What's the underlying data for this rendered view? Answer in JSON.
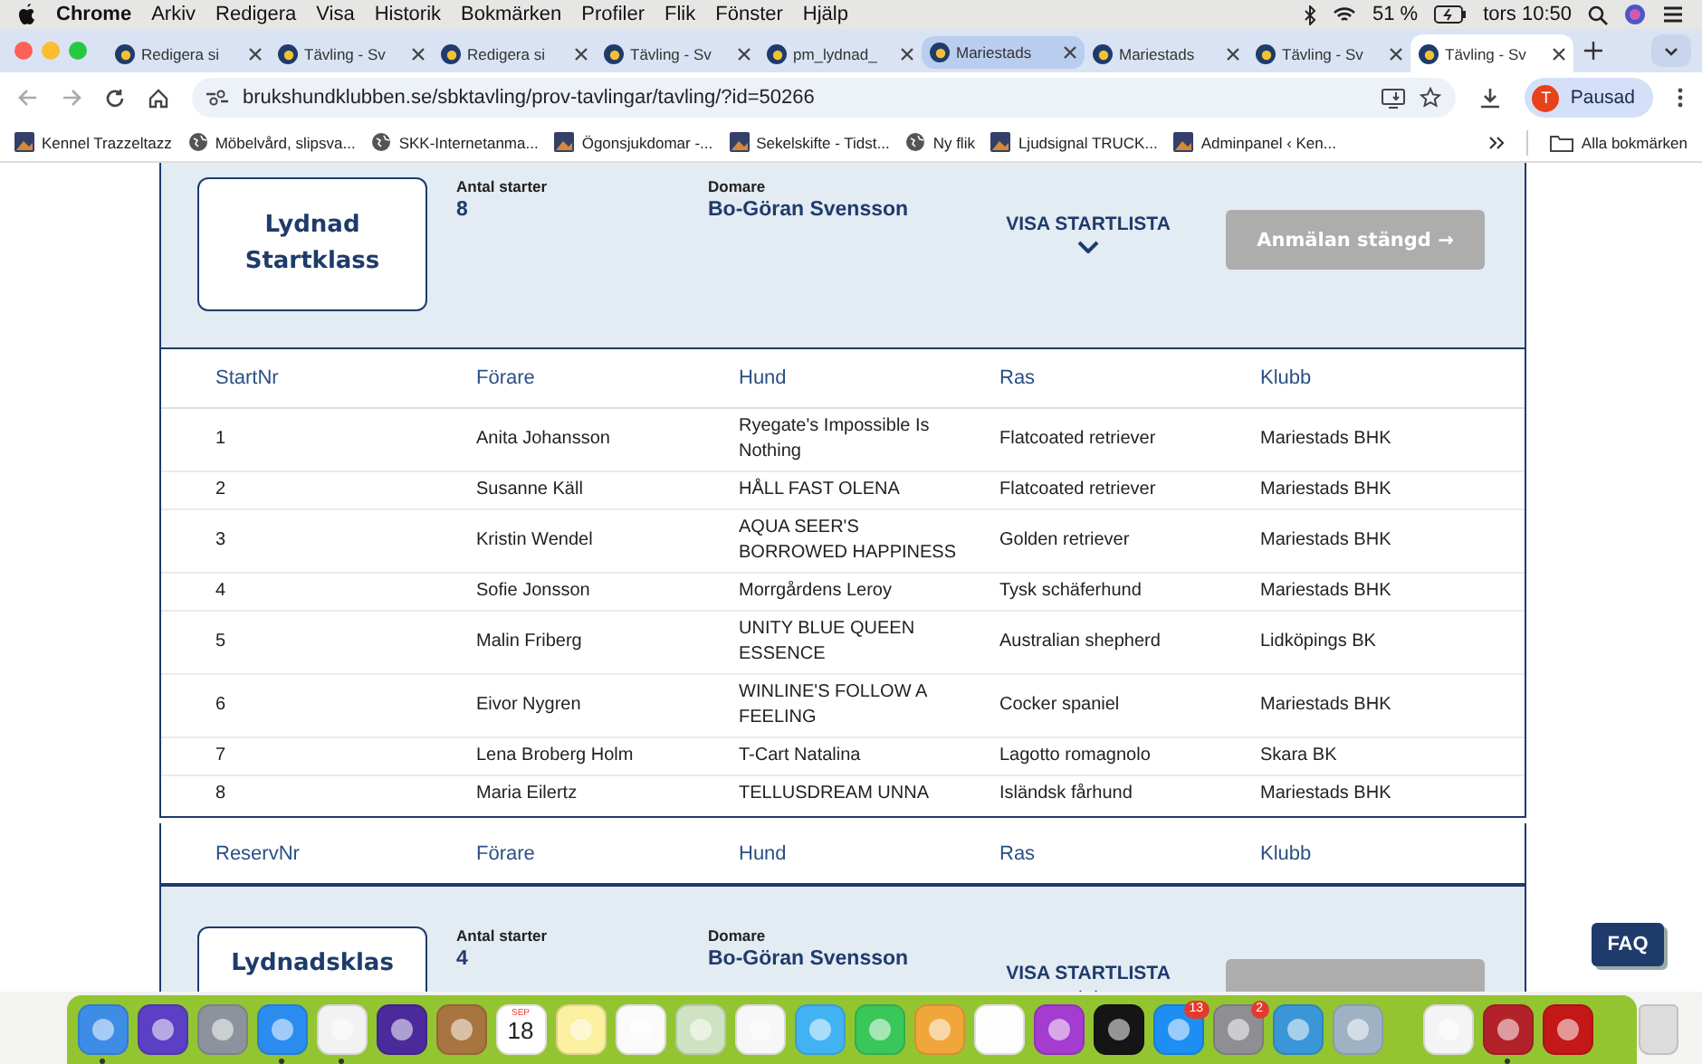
{
  "menubar": {
    "app": "Chrome",
    "menus": [
      "Arkiv",
      "Redigera",
      "Visa",
      "Historik",
      "Bokmärken",
      "Profiler",
      "Flik",
      "Fönster",
      "Hjälp"
    ],
    "battery": "51 %",
    "clock": "tors 10:50"
  },
  "tabs": [
    {
      "title": "Redigera si",
      "selected": false,
      "highlighted": false
    },
    {
      "title": "Tävling - Sv",
      "selected": false,
      "highlighted": false
    },
    {
      "title": "Redigera si",
      "selected": false,
      "highlighted": false
    },
    {
      "title": "Tävling - Sv",
      "selected": false,
      "highlighted": false
    },
    {
      "title": "pm_lydnad_",
      "selected": false,
      "highlighted": false
    },
    {
      "title": "Mariestads",
      "selected": false,
      "highlighted": true
    },
    {
      "title": "Mariestads",
      "selected": false,
      "highlighted": false
    },
    {
      "title": "Tävling - Sv",
      "selected": false,
      "highlighted": false
    },
    {
      "title": "Tävling - Sv",
      "selected": true,
      "highlighted": false
    }
  ],
  "address": {
    "url": "brukshundklubben.se/sbktavling/prov-tavlingar/tavling/?id=50266"
  },
  "profile": {
    "avatar": "T",
    "label": "Pausad"
  },
  "bookmarks": [
    {
      "label": "Kennel Trazzeltazz",
      "kind": "image"
    },
    {
      "label": "Möbelvård, slipsva...",
      "kind": "globe"
    },
    {
      "label": "SKK-Internetanma...",
      "kind": "globe"
    },
    {
      "label": "Ögonsjukdomar -...",
      "kind": "image"
    },
    {
      "label": "Sekelskifte - Tidst...",
      "kind": "image"
    },
    {
      "label": "Ny flik",
      "kind": "globe"
    },
    {
      "label": "Ljudsignal TRUCK...",
      "kind": "image"
    },
    {
      "label": "Adminpanel ‹ Ken...",
      "kind": "image"
    }
  ],
  "all_bookmarks": "Alla bokmärken",
  "classes": [
    {
      "name": "Lydnad Startklass",
      "starts_label": "Antal starter",
      "starts": "8",
      "judge_label": "Domare",
      "judge": "Bo-Göran Svensson",
      "toggle": "VISA STARTLISTA",
      "button": "Anmälan stängd →",
      "disabled": true,
      "table": {
        "columns": [
          "StartNr",
          "Förare",
          "Hund",
          "Ras",
          "Klubb"
        ],
        "rows": [
          [
            "1",
            "Anita Johansson",
            "Ryegate's Impossible Is Nothing",
            "Flatcoated retriever",
            "Mariestads BHK"
          ],
          [
            "2",
            "Susanne Käll",
            "HÅLL FAST OLENA",
            "Flatcoated retriever",
            "Mariestads BHK"
          ],
          [
            "3",
            "Kristin Wendel",
            "AQUA SEER'S BORROWED HAPPINESS",
            "Golden retriever",
            "Mariestads BHK"
          ],
          [
            "4",
            "Sofie Jonsson",
            "Morrgårdens Leroy",
            "Tysk schäferhund",
            "Mariestads BHK"
          ],
          [
            "5",
            "Malin Friberg",
            "UNITY BLUE QUEEN ESSENCE",
            "Australian shepherd",
            "Lidköpings BK"
          ],
          [
            "6",
            "Eivor Nygren",
            "WINLINE'S FOLLOW A FEELING",
            "Cocker spaniel",
            "Mariestads BHK"
          ],
          [
            "7",
            "Lena Broberg Holm",
            "T-Cart Natalina",
            "Lagotto romagnolo",
            "Skara BK"
          ],
          [
            "8",
            "Maria Eilertz",
            "TELLUSDREAM UNNA",
            "Isländsk fårhund",
            "Mariestads BHK"
          ]
        ]
      },
      "reserve_columns": [
        "ReservNr",
        "Förare",
        "Hund",
        "Ras",
        "Klubb"
      ]
    },
    {
      "name": "Lydnadsklas",
      "starts_label": "Antal starter",
      "starts": "4",
      "judge_label": "Domare",
      "judge": "Bo-Göran Svensson",
      "toggle": "VISA STARTLISTA",
      "disabled": true
    }
  ],
  "faq": "FAQ",
  "dock": [
    {
      "kind": "app",
      "color": "#3d8de6",
      "running": true
    },
    {
      "kind": "app",
      "color": "#5b3fc4",
      "running": false
    },
    {
      "kind": "app",
      "color": "#8d939c",
      "running": false
    },
    {
      "kind": "app",
      "color": "#2b8cf0",
      "running": true
    },
    {
      "kind": "app",
      "color": "#f2f2f2",
      "running": true
    },
    {
      "kind": "app",
      "color": "#4b2a9c",
      "running": false
    },
    {
      "kind": "app",
      "color": "#a8743f",
      "running": false
    },
    {
      "kind": "calendar",
      "color": "#ffffff",
      "running": false,
      "month": "SEP",
      "date": "18"
    },
    {
      "kind": "app",
      "color": "#fbefa0",
      "running": false
    },
    {
      "kind": "app",
      "color": "#fafafa",
      "running": false
    },
    {
      "kind": "app",
      "color": "#cfe3c2",
      "running": false
    },
    {
      "kind": "app",
      "color": "#f7f7f7",
      "running": false
    },
    {
      "kind": "app",
      "color": "#42b3f2",
      "running": false
    },
    {
      "kind": "app",
      "color": "#3ac75a",
      "running": false
    },
    {
      "kind": "app",
      "color": "#f1a63c",
      "running": false
    },
    {
      "kind": "app",
      "color": "#fdfdfd",
      "running": false
    },
    {
      "kind": "app",
      "color": "#a43ccf",
      "running": false
    },
    {
      "kind": "app",
      "color": "#151515",
      "running": false
    },
    {
      "kind": "app",
      "color": "#1d8ef3",
      "running": false,
      "badge": "13"
    },
    {
      "kind": "app",
      "color": "#8e8e93",
      "running": false,
      "badge": "2"
    },
    {
      "kind": "app",
      "color": "#3a96d6",
      "running": false
    },
    {
      "kind": "app",
      "color": "#9fb2c4",
      "running": false
    },
    {
      "kind": "separator"
    },
    {
      "kind": "app",
      "color": "#f4f4f4",
      "running": false
    },
    {
      "kind": "app",
      "color": "#b3222a",
      "running": true
    },
    {
      "kind": "app",
      "color": "#c41717",
      "running": false
    },
    {
      "kind": "separator"
    },
    {
      "kind": "trash",
      "color": "#dcdcdc",
      "running": false
    }
  ]
}
